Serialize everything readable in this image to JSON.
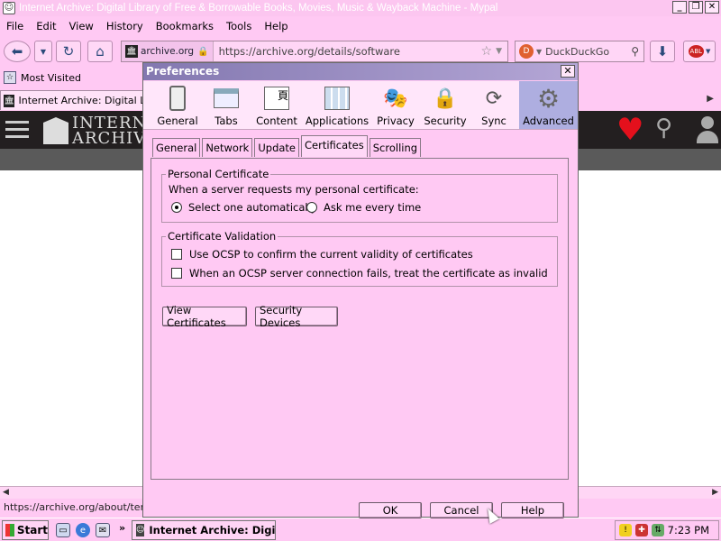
{
  "window": {
    "title": "Internet Archive: Digital Library of Free & Borrowable Books, Movies, Music & Wayback Machine - Mypal",
    "controls": [
      "_",
      "❐",
      "✕"
    ]
  },
  "menubar": [
    "File",
    "Edit",
    "View",
    "History",
    "Bookmarks",
    "Tools",
    "Help"
  ],
  "navbar": {
    "site_identity": "archive.org",
    "url": "https://archive.org/details/software",
    "search_engine": "DuckDuckGo",
    "abp_label": "ABL"
  },
  "bookmarks": {
    "most_visited": "Most Visited"
  },
  "tab": {
    "label": "Internet Archive: Digital Libr"
  },
  "page": {
    "logo_line1": "INTERNET",
    "logo_line2": "ARCHIVE"
  },
  "status_url": "https://archive.org/about/terms",
  "taskbar": {
    "start": "Start",
    "task_label": "Internet Archive: Digi...",
    "overflow": "»",
    "clock": "7:23 PM"
  },
  "dialog": {
    "title": "Preferences",
    "panes": [
      {
        "label": "General",
        "icon": "general-icon"
      },
      {
        "label": "Tabs",
        "icon": "tabs-icon"
      },
      {
        "label": "Content",
        "icon": "content-icon"
      },
      {
        "label": "Applications",
        "icon": "applications-icon"
      },
      {
        "label": "Privacy",
        "icon": "privacy-mask-icon"
      },
      {
        "label": "Security",
        "icon": "padlock-icon"
      },
      {
        "label": "Sync",
        "icon": "sync-icon"
      },
      {
        "label": "Advanced",
        "icon": "gear-icon"
      }
    ],
    "active_pane": "Advanced",
    "subtabs": [
      "General",
      "Network",
      "Update",
      "Certificates",
      "Scrolling"
    ],
    "active_subtab": "Certificates",
    "personal_certificate": {
      "legend": "Personal Certificate",
      "prompt": "When a server requests my personal certificate:",
      "option_auto": "Select one automatically",
      "option_ask": "Ask me every time",
      "selected": "Select one automatically"
    },
    "certificate_validation": {
      "legend": "Certificate Validation",
      "ocsp_label": "Use OCSP to confirm the current validity of certificates",
      "ocsp_checked": false,
      "fail_label": "When an OCSP server connection fails, treat the certificate as invalid",
      "fail_checked": false
    },
    "buttons": {
      "view_certificates": "View Certificates",
      "security_devices": "Security Devices",
      "ok": "OK",
      "cancel": "Cancel",
      "help": "Help"
    }
  }
}
